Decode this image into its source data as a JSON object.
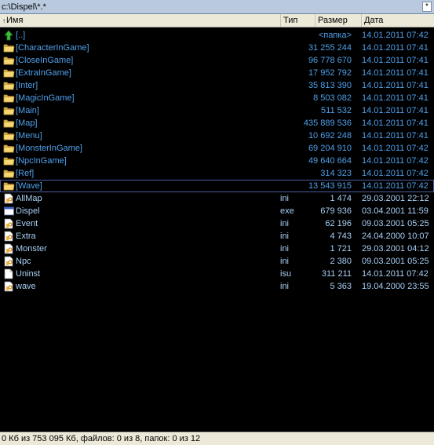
{
  "path_bar": {
    "path": "c:\\Dispel\\*.*",
    "history_button": "*"
  },
  "columns": {
    "name": "Имя",
    "type": "Тип",
    "size": "Размер",
    "date": "Дата"
  },
  "rows": [
    {
      "kind": "up",
      "name": "[..]",
      "type": "",
      "size": "<папка>",
      "date": "14.01.2011 07:42",
      "icon": "up-arrow-icon"
    },
    {
      "kind": "dir",
      "name": "[CharacterInGame]",
      "type": "",
      "size": "31 255 244",
      "date": "14.01.2011 07:41",
      "icon": "folder-icon"
    },
    {
      "kind": "dir",
      "name": "[CloseInGame]",
      "type": "",
      "size": "96 778 670",
      "date": "14.01.2011 07:41",
      "icon": "folder-icon"
    },
    {
      "kind": "dir",
      "name": "[ExtraInGame]",
      "type": "",
      "size": "17 952 792",
      "date": "14.01.2011 07:41",
      "icon": "folder-icon"
    },
    {
      "kind": "dir",
      "name": "[Inter]",
      "type": "",
      "size": "35 813 390",
      "date": "14.01.2011 07:41",
      "icon": "folder-icon"
    },
    {
      "kind": "dir",
      "name": "[MagicInGame]",
      "type": "",
      "size": "8 503 082",
      "date": "14.01.2011 07:41",
      "icon": "folder-icon"
    },
    {
      "kind": "dir",
      "name": "[Main]",
      "type": "",
      "size": "511 532",
      "date": "14.01.2011 07:41",
      "icon": "folder-icon"
    },
    {
      "kind": "dir",
      "name": "[Map]",
      "type": "",
      "size": "435 889 536",
      "date": "14.01.2011 07:41",
      "icon": "folder-icon"
    },
    {
      "kind": "dir",
      "name": "[Menu]",
      "type": "",
      "size": "10 692 248",
      "date": "14.01.2011 07:41",
      "icon": "folder-icon"
    },
    {
      "kind": "dir",
      "name": "[MonsterInGame]",
      "type": "",
      "size": "69 204 910",
      "date": "14.01.2011 07:42",
      "icon": "folder-icon"
    },
    {
      "kind": "dir",
      "name": "[NpcInGame]",
      "type": "",
      "size": "49 640 664",
      "date": "14.01.2011 07:42",
      "icon": "folder-icon"
    },
    {
      "kind": "dir",
      "name": "[Ref]",
      "type": "",
      "size": "314 323",
      "date": "14.01.2011 07:42",
      "icon": "folder-icon"
    },
    {
      "kind": "dir",
      "name": "[Wave]",
      "type": "",
      "size": "13 543 915",
      "date": "14.01.2011 07:42",
      "icon": "folder-icon",
      "selected": true
    },
    {
      "kind": "file",
      "name": "AllMap",
      "type": "ini",
      "size": "1 474",
      "date": "29.03.2001 22:12",
      "icon": "ini-file-icon"
    },
    {
      "kind": "file",
      "name": "Dispel",
      "type": "exe",
      "size": "679 936",
      "date": "03.04.2001 11:59",
      "icon": "exe-file-icon"
    },
    {
      "kind": "file",
      "name": "Event",
      "type": "ini",
      "size": "62 196",
      "date": "09.03.2001 05:25",
      "icon": "ini-file-icon"
    },
    {
      "kind": "file",
      "name": "Extra",
      "type": "ini",
      "size": "4 743",
      "date": "24.04.2000 10:07",
      "icon": "ini-file-icon"
    },
    {
      "kind": "file",
      "name": "Monster",
      "type": "ini",
      "size": "1 721",
      "date": "29.03.2001 04:12",
      "icon": "ini-file-icon"
    },
    {
      "kind": "file",
      "name": "Npc",
      "type": "ini",
      "size": "2 380",
      "date": "09.03.2001 05:25",
      "icon": "ini-file-icon"
    },
    {
      "kind": "file",
      "name": "Uninst",
      "type": "isu",
      "size": "311 211",
      "date": "14.01.2011 07:42",
      "icon": "isu-file-icon"
    },
    {
      "kind": "file",
      "name": "wave",
      "type": "ini",
      "size": "5 363",
      "date": "19.04.2000 23:55",
      "icon": "ini-file-icon"
    }
  ],
  "status": {
    "text": "0 Кб из 753 095 Кб, файлов: 0 из 8, папок: 0 из 12"
  },
  "colors": {
    "background": "#000000",
    "folder_text": "#4fa0ea",
    "file_text": "#a9d0f5",
    "path_bar": "#b9c9de",
    "selection_outline": "#4d5da0"
  }
}
